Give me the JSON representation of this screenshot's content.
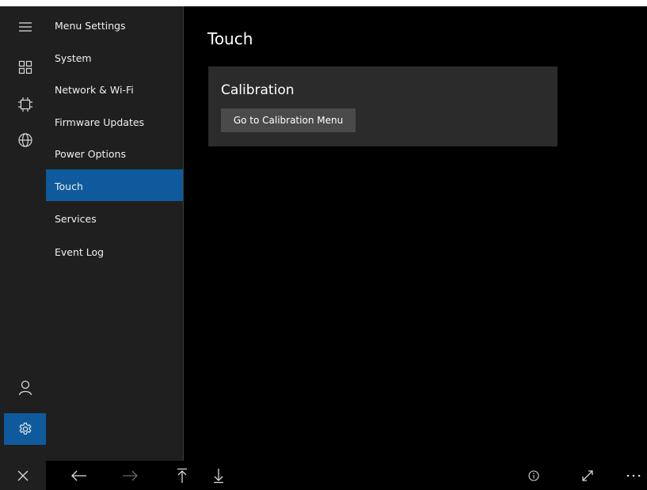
{
  "rail": {
    "items": [
      {
        "icon": "hamburger-menu-icon"
      },
      {
        "icon": "dashboard-grid-icon"
      },
      {
        "icon": "chip-icon"
      },
      {
        "icon": "globe-icon"
      },
      {
        "icon": "user-icon"
      },
      {
        "icon": "gear-icon",
        "active": true
      }
    ]
  },
  "menu": {
    "items": [
      {
        "label": "Menu Settings"
      },
      {
        "label": "System"
      },
      {
        "label": "Network & Wi-Fi"
      },
      {
        "label": "Firmware Updates"
      },
      {
        "label": "Power Options"
      },
      {
        "label": "Touch",
        "active": true
      },
      {
        "label": "Services"
      },
      {
        "label": "Event Log"
      }
    ]
  },
  "content": {
    "title": "Touch",
    "calibration": {
      "title": "Calibration",
      "button_label": "Go to Calibration Menu"
    }
  },
  "toolbar": {
    "icons": [
      "close-icon",
      "back-arrow-icon",
      "forward-arrow-icon",
      "scroll-to-top-icon",
      "scroll-to-bottom-icon",
      "info-icon",
      "expand-icon",
      "more-icon"
    ]
  },
  "colors": {
    "accent": "#0e5a9c",
    "pane": "#1f1f1f",
    "card": "#2b2b2b",
    "button": "#4a4a4a",
    "background": "#000000"
  }
}
